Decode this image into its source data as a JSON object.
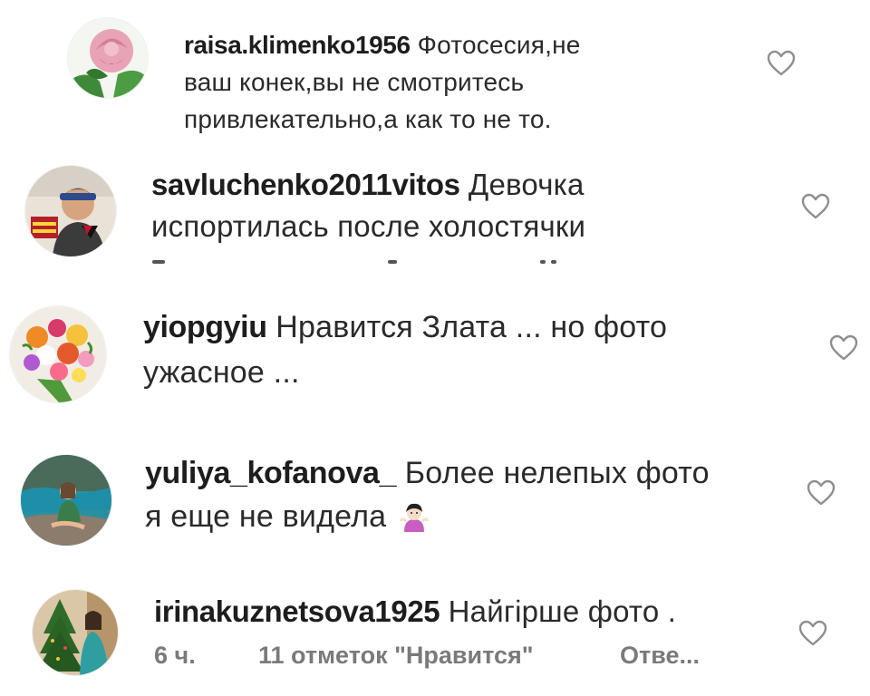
{
  "comments": [
    {
      "username": "raisa.klimenko1956",
      "text_line1": "Фотосесия,не",
      "text_line2": "ваш конек,вы не  смотритесь",
      "text_line3": "привлекательно,а как то не то."
    },
    {
      "username": "savluchenko2011vitos",
      "text_line1": "Девочка",
      "text_line2": "испортилась после холостячки"
    },
    {
      "username": "yiopgyiu",
      "text_line1": "Нравится Злата ... но  фото",
      "text_line2": "ужасное ..."
    },
    {
      "username": "yuliya_kofanova_",
      "text_line1": "Более нелепых фото",
      "text_line2": "я еще не видела"
    },
    {
      "username": "irinakuznetsova1925",
      "text_line1": "Найгірше фото .",
      "time": "6 ч.",
      "likes": "11 отметок \"Нравится\"",
      "reply": "Отве..."
    }
  ],
  "icons": {
    "like": "heart-outline-icon",
    "emoji": "woman-shrugging-emoji"
  },
  "colors": {
    "text": "#262626",
    "meta": "#8e8e8e",
    "heart": "#8e8e8e"
  }
}
